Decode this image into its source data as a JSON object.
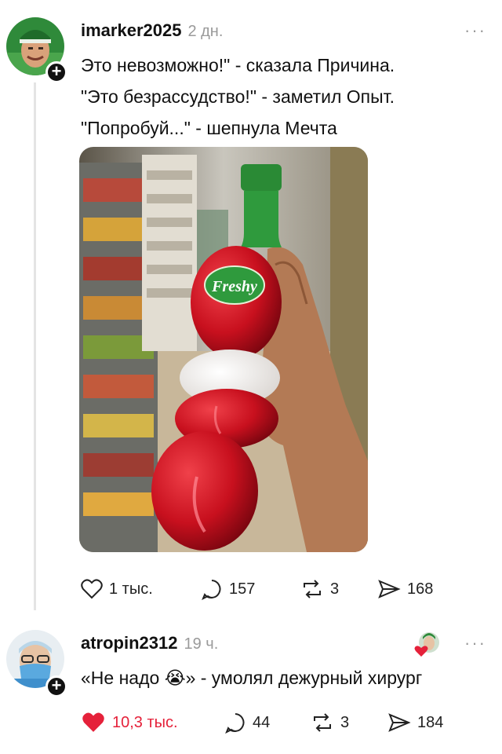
{
  "post1": {
    "username": "imarker2025",
    "time": "2 дн.",
    "more": "···",
    "lines": [
      "Это невозможно!\" - сказала Причина.",
      "\"Это безрассудство!\" - заметил Опыт.",
      "\"Попробуй...\" - шепнула Мечта"
    ],
    "image": {
      "label": "Fresh",
      "label_tail": "y"
    },
    "likes": "1 тыс.",
    "comments": "157",
    "reposts": "3",
    "shares": "168",
    "avatar_icon": "follow-plus-icon"
  },
  "post2": {
    "username": "atropin2312",
    "time": "19 ч.",
    "more": "···",
    "text_before": "«Не надо ",
    "emoji": "😭",
    "text_after": "» - умолял дежурный хирург",
    "likes": "10,3 тыс.",
    "comments": "44",
    "reposts": "3",
    "shares": "184",
    "like_color": "#e5213a"
  }
}
